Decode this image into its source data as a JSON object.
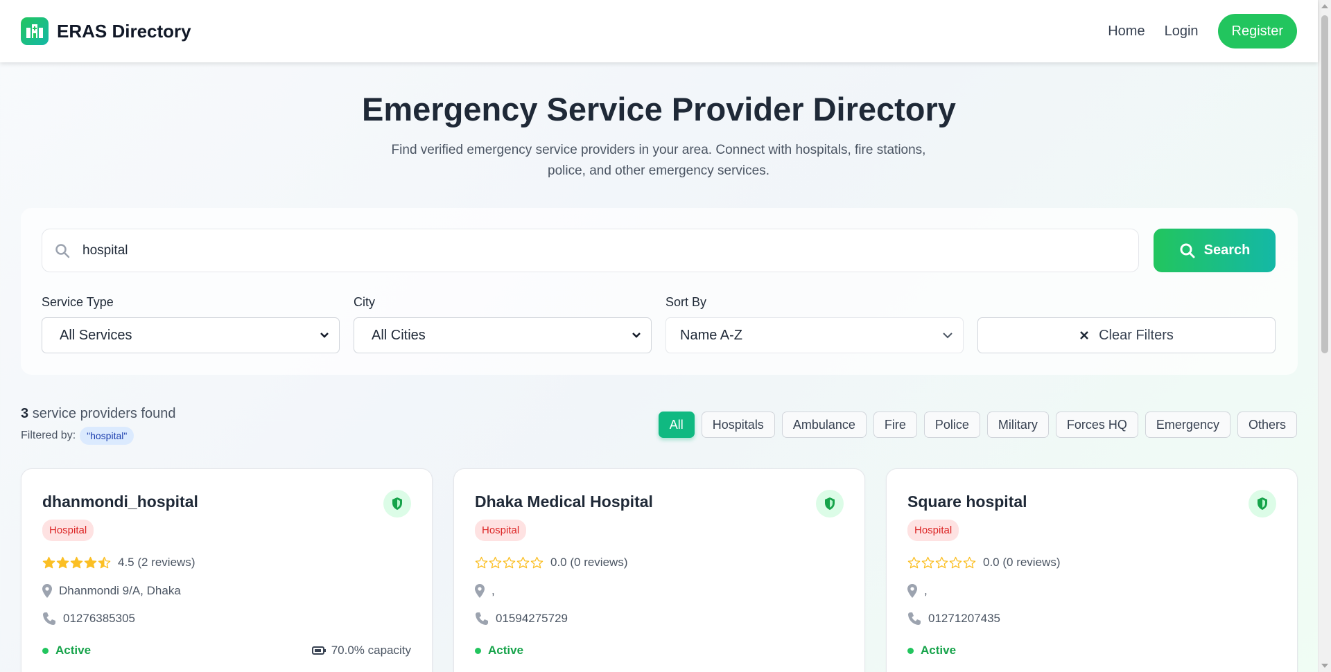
{
  "navbar": {
    "brand": "ERAS Directory",
    "links": [
      "Home",
      "Login"
    ],
    "register": "Register"
  },
  "hero": {
    "title": "Emergency Service Provider Directory",
    "subtitle": "Find verified emergency service providers in your area. Connect with hospitals, fire stations, police, and other emergency services."
  },
  "search": {
    "value": "hospital",
    "button": "Search"
  },
  "filters": {
    "service_type": {
      "label": "Service Type",
      "value": "All Services"
    },
    "city": {
      "label": "City",
      "value": "All Cities"
    },
    "sort_by": {
      "label": "Sort By",
      "value": "Name A-Z"
    },
    "clear": "Clear Filters"
  },
  "results": {
    "count": "3",
    "count_suffix": "service providers found",
    "filtered_by_label": "Filtered by:",
    "filter_chip": "\"hospital\""
  },
  "type_tabs": [
    "All",
    "Hospitals",
    "Ambulance",
    "Fire",
    "Police",
    "Military",
    "Forces HQ",
    "Emergency",
    "Others"
  ],
  "active_tab": "All",
  "providers": [
    {
      "name": "dhanmondi_hospital",
      "type": "Hospital",
      "rating": 4.5,
      "rating_text": "4.5 (2 reviews)",
      "address": "Dhanmondi 9/A, Dhaka",
      "phone": "01276385305",
      "status": "Active",
      "capacity": "70.0% capacity"
    },
    {
      "name": "Dhaka Medical Hospital",
      "type": "Hospital",
      "rating": 0,
      "rating_text": "0.0 (0 reviews)",
      "address": ",",
      "phone": "01594275729",
      "status": "Active",
      "capacity": ""
    },
    {
      "name": "Square hospital",
      "type": "Hospital",
      "rating": 0,
      "rating_text": "0.0 (0 reviews)",
      "address": ",",
      "phone": "01271207435",
      "status": "Active",
      "capacity": ""
    }
  ],
  "colors": {
    "primary": "#22c55e",
    "accent": "#14b8a6",
    "active_tab": "#10b981",
    "badge_bg": "#fee2e2",
    "badge_text": "#dc2626",
    "star": "#fbbf24",
    "status": "#16a34a"
  }
}
